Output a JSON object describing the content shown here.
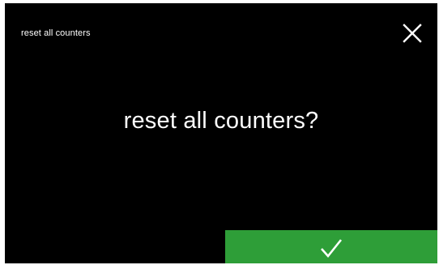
{
  "header": {
    "title": "reset all counters"
  },
  "dialog": {
    "question": "reset all counters?"
  },
  "icons": {
    "close": "close-icon",
    "confirm": "checkmark-icon"
  },
  "colors": {
    "background": "#000000",
    "text": "#ffffff",
    "confirm_button": "#2e9e38"
  }
}
